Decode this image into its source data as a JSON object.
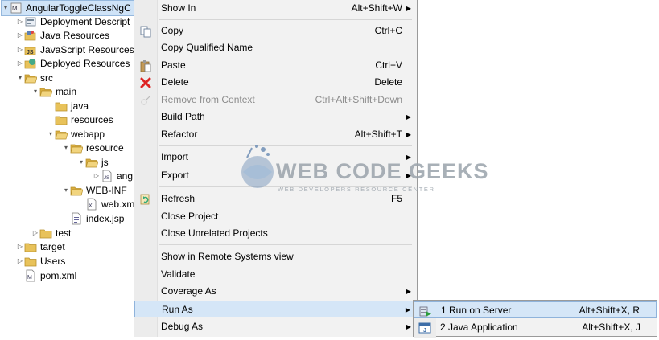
{
  "tree": {
    "items": [
      {
        "label": "AngularToggleClassNgC",
        "icon": "maven-project-icon",
        "twisty": "▾",
        "selected": true
      },
      {
        "label": "Deployment Descript",
        "icon": "deployment-descriptor-icon",
        "twisty": "▷"
      },
      {
        "label": "Java Resources",
        "icon": "java-resources-icon",
        "twisty": "▷"
      },
      {
        "label": "JavaScript Resources",
        "icon": "javascript-resources-icon",
        "twisty": "▷"
      },
      {
        "label": "Deployed Resources",
        "icon": "deployed-resources-icon",
        "twisty": "▷"
      },
      {
        "label": "src",
        "icon": "folder-open-icon",
        "twisty": "▾"
      },
      {
        "label": "main",
        "icon": "folder-open-icon",
        "twisty": "▾"
      },
      {
        "label": "java",
        "icon": "folder-icon",
        "twisty": ""
      },
      {
        "label": "resources",
        "icon": "folder-icon",
        "twisty": ""
      },
      {
        "label": "webapp",
        "icon": "folder-open-icon",
        "twisty": "▾"
      },
      {
        "label": "resource",
        "icon": "folder-open-icon",
        "twisty": "▾"
      },
      {
        "label": "js",
        "icon": "folder-open-icon",
        "twisty": "▾"
      },
      {
        "label": "ang",
        "icon": "js-file-icon",
        "twisty": "▷"
      },
      {
        "label": "WEB-INF",
        "icon": "folder-open-icon",
        "twisty": "▾"
      },
      {
        "label": "web.xm",
        "icon": "xml-file-icon",
        "twisty": ""
      },
      {
        "label": "index.jsp",
        "icon": "jsp-file-icon",
        "twisty": ""
      },
      {
        "label": "test",
        "icon": "folder-icon",
        "twisty": "▷"
      },
      {
        "label": "target",
        "icon": "folder-icon",
        "twisty": "▷"
      },
      {
        "label": "Users",
        "icon": "folder-icon",
        "twisty": "▷"
      },
      {
        "label": "pom.xml",
        "icon": "pom-file-icon",
        "twisty": ""
      }
    ]
  },
  "menu": {
    "items": [
      {
        "label": "Show In",
        "shortcut": "Alt+Shift+W",
        "submenu": true
      },
      {
        "label": "Copy",
        "shortcut": "Ctrl+C",
        "icon": "copy-icon"
      },
      {
        "label": "Copy Qualified Name",
        "shortcut": ""
      },
      {
        "label": "Paste",
        "shortcut": "Ctrl+V",
        "icon": "paste-icon"
      },
      {
        "label": "Delete",
        "shortcut": "Delete",
        "icon": "delete-icon"
      },
      {
        "label": "Remove from Context",
        "shortcut": "Ctrl+Alt+Shift+Down",
        "icon": "remove-context-icon",
        "disabled": true
      },
      {
        "label": "Build Path",
        "shortcut": "",
        "submenu": true
      },
      {
        "label": "Refactor",
        "shortcut": "Alt+Shift+T",
        "submenu": true
      },
      {
        "label": "Import",
        "shortcut": "",
        "submenu": true,
        "icon": "import-icon"
      },
      {
        "label": "Export",
        "shortcut": "",
        "submenu": true,
        "icon": "export-icon"
      },
      {
        "label": "Refresh",
        "shortcut": "F5",
        "icon": "refresh-icon"
      },
      {
        "label": "Close Project",
        "shortcut": ""
      },
      {
        "label": "Close Unrelated Projects",
        "shortcut": ""
      },
      {
        "label": "Show in Remote Systems view",
        "shortcut": ""
      },
      {
        "label": "Validate",
        "shortcut": ""
      },
      {
        "label": "Coverage As",
        "shortcut": "",
        "submenu": true
      },
      {
        "label": "Run As",
        "shortcut": "",
        "submenu": true,
        "active": true
      },
      {
        "label": "Debug As",
        "shortcut": "",
        "submenu": true
      }
    ]
  },
  "submenu": {
    "items": [
      {
        "label": "1 Run on Server",
        "shortcut": "Alt+Shift+X, R",
        "icon": "run-on-server-icon",
        "active": true
      },
      {
        "label": "2 Java Application",
        "shortcut": "Alt+Shift+X, J",
        "icon": "java-application-icon"
      }
    ]
  },
  "watermark": {
    "title": "WEB CODE GEEKS",
    "subtitle": "WEB DEVELOPERS RESOURCE CENTER"
  },
  "colors": {
    "menu_bg": "#f2f2f2",
    "highlight": "#d5e6f7",
    "highlight_border": "#8fb3db",
    "disabled_text": "#8c8c8c",
    "folder": "#e8c25a"
  }
}
